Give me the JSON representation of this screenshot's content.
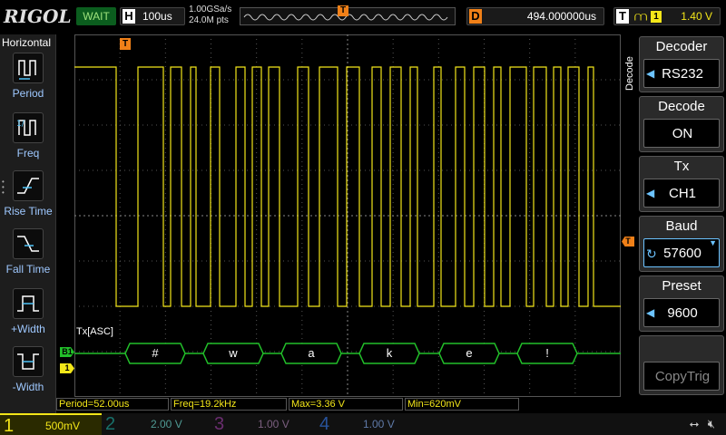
{
  "topbar": {
    "logo": "RIGOL",
    "run_status": "WAIT",
    "h_tag": "H",
    "timebase": "100us",
    "sample_rate": "1.00GSa/s",
    "mem_depth": "24.0M pts",
    "trigger_pos_marker": "T",
    "d_tag": "D",
    "delay": "494.000000us",
    "t_tag": "T",
    "trigger_source": "1",
    "trigger_level": "1.40 V"
  },
  "left_menu": {
    "title": "Horizontal",
    "items": [
      {
        "label": "Period",
        "icon": "period-icon"
      },
      {
        "label": "Freq",
        "icon": "freq-icon"
      },
      {
        "label": "Rise Time",
        "icon": "rise-time-icon"
      },
      {
        "label": "Fall Time",
        "icon": "fall-time-icon"
      },
      {
        "label": "+Width",
        "icon": "pos-width-icon"
      },
      {
        "label": "-Width",
        "icon": "neg-width-icon"
      }
    ]
  },
  "scope": {
    "trigger_marker_top": "T",
    "trigger_level_marker": "T",
    "decode_label": "Tx[ASC]",
    "bus_marker": "B1",
    "ch1_marker": "1",
    "decoded_chars": [
      "#",
      "w",
      "a",
      "k",
      "e",
      "!"
    ],
    "colors": {
      "ch1": "#f3e619",
      "bus": "#22c02a",
      "trigger": "#f08018",
      "grid": "#555555"
    }
  },
  "right_menu": {
    "vertical_tab": "Decode",
    "items": [
      {
        "label": "Decoder",
        "value": "RS232"
      },
      {
        "label": "Decode",
        "value": "ON"
      },
      {
        "label": "Tx",
        "value": "CH1"
      },
      {
        "label": "Baud",
        "value": "57600"
      },
      {
        "label": "Preset",
        "value": "9600"
      },
      {
        "label": "",
        "value": "CopyTrig"
      }
    ]
  },
  "measurements": {
    "period": "Period=52.00us",
    "freq": "Freq=19.2kHz",
    "max": "Max=3.36 V",
    "min": "Min=620mV"
  },
  "bottombar": {
    "ch1": {
      "num": "1",
      "scale": "500mV"
    },
    "ch2": {
      "num": "2",
      "scale": "2.00 V"
    },
    "ch3": {
      "num": "3",
      "scale": "1.00 V"
    },
    "ch4": {
      "num": "4",
      "scale": "1.00 V"
    },
    "icons": [
      "usb-icon",
      "speaker-muted-icon"
    ]
  }
}
